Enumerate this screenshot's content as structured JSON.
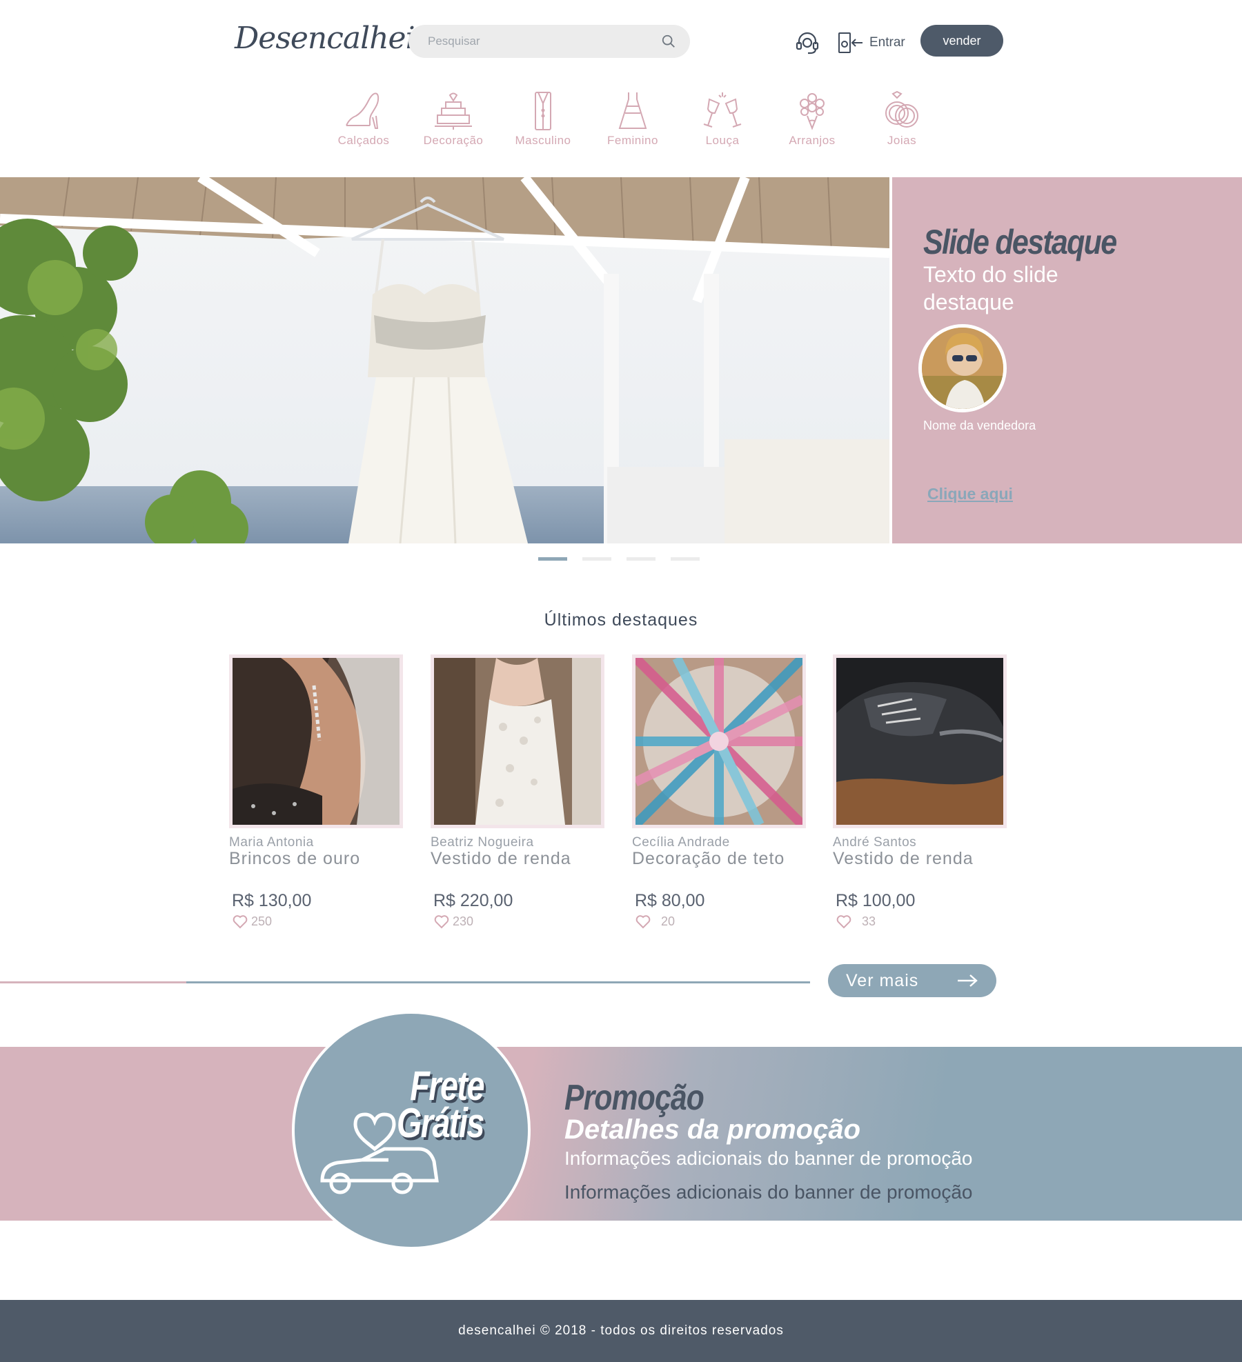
{
  "header": {
    "logo_text": "Desencalhei",
    "search_placeholder": "Pesquisar",
    "login_label": "Entrar",
    "sell_label": "vender"
  },
  "categories": [
    {
      "label": "Calçados",
      "icon": "heel-shoe-icon"
    },
    {
      "label": "Decoração",
      "icon": "cake-icon"
    },
    {
      "label": "Masculino",
      "icon": "suit-icon"
    },
    {
      "label": "Feminino",
      "icon": "dress-icon"
    },
    {
      "label": "Louça",
      "icon": "champagne-glasses-icon"
    },
    {
      "label": "Arranjos",
      "icon": "bouquet-icon"
    },
    {
      "label": "Joias",
      "icon": "rings-icon"
    }
  ],
  "hero": {
    "slide_title": "Slide destaque",
    "slide_text": "Texto do slide destaque",
    "seller_name": "Nome da vendedora",
    "cta": "Clique aqui",
    "slides_count": 4,
    "active_slide": 1
  },
  "highlights": {
    "title": "Últimos destaques",
    "items": [
      {
        "seller": "Maria Antonia",
        "name": "Brincos de ouro",
        "price": "R$ 130,00",
        "likes": "250"
      },
      {
        "seller": "Beatriz Nogueira",
        "name": "Vestido de renda",
        "price": "R$ 220,00",
        "likes": "230"
      },
      {
        "seller": "Cecília Andrade",
        "name": "Decoração de teto",
        "price": "R$ 80,00",
        "likes": "20"
      },
      {
        "seller": "André Santos",
        "name": "Vestido de renda",
        "price": "R$ 100,00",
        "likes": "33"
      }
    ],
    "more_label": "Ver mais"
  },
  "promo": {
    "badge_line1": "Frete",
    "badge_line2": "Grátis",
    "title": "Promoção",
    "details": "Detalhes da promoção",
    "info1": "Informações adicionais do banner de promoção",
    "info2": "Informações adicionais do banner de promoção"
  },
  "footer": {
    "text": "desencalhei © 2018 - todos os direitos reservados"
  },
  "colors": {
    "pink": "#d6b3bc",
    "blue": "#8ea7b6",
    "dark": "#4f5a68",
    "category_text": "#d4a8b3"
  }
}
